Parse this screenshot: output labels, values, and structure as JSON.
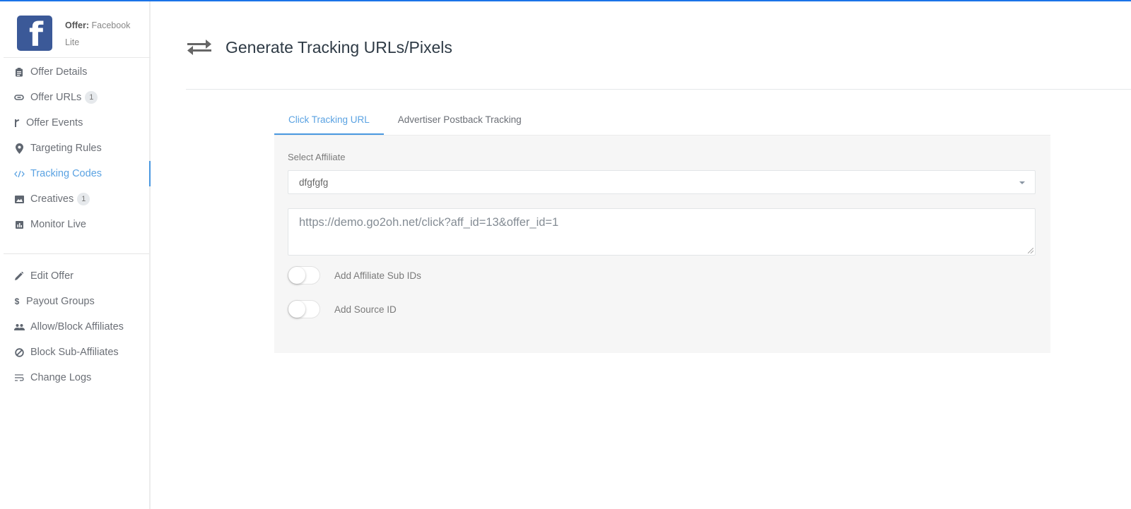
{
  "colors": {
    "accent": "#4a98e0",
    "facebook": "#3b5998",
    "topbar": "#1a73e8"
  },
  "offer": {
    "label": "Offer:",
    "name": "Facebook Lite",
    "logo_icon": "facebook-icon"
  },
  "sidebar": {
    "primary": [
      {
        "label": "Offer Details",
        "icon": "clipboard-icon"
      },
      {
        "label": "Offer URLs",
        "icon": "link-icon",
        "badge": "1"
      },
      {
        "label": "Offer Events",
        "icon": "branch-icon"
      },
      {
        "label": "Targeting Rules",
        "icon": "map-pin-icon"
      },
      {
        "label": "Tracking Codes",
        "icon": "code-icon",
        "active": true
      },
      {
        "label": "Creatives",
        "icon": "image-icon",
        "badge": "1"
      },
      {
        "label": "Monitor Live",
        "icon": "bar-chart-icon"
      }
    ],
    "secondary": [
      {
        "label": "Edit Offer",
        "icon": "pencil-icon"
      },
      {
        "label": "Payout Groups",
        "icon": "dollar-icon"
      },
      {
        "label": "Allow/Block Affiliates",
        "icon": "people-icon"
      },
      {
        "label": "Block Sub-Affiliates",
        "icon": "block-icon"
      },
      {
        "label": "Change Logs",
        "icon": "list-wrap-icon"
      }
    ]
  },
  "page": {
    "title": "Generate Tracking URLs/Pixels",
    "icon": "swap-arrows-icon"
  },
  "tabs": [
    {
      "label": "Click Tracking URL",
      "active": true
    },
    {
      "label": "Advertiser Postback Tracking",
      "active": false
    }
  ],
  "form": {
    "affiliate_label": "Select Affiliate",
    "affiliate_value": "dfgfgfg",
    "tracking_url": "https://demo.go2oh.net/click?aff_id=13&offer_id=1",
    "toggles": [
      {
        "label": "Add Affiliate Sub IDs",
        "on": false
      },
      {
        "label": "Add Source ID",
        "on": false
      }
    ]
  }
}
